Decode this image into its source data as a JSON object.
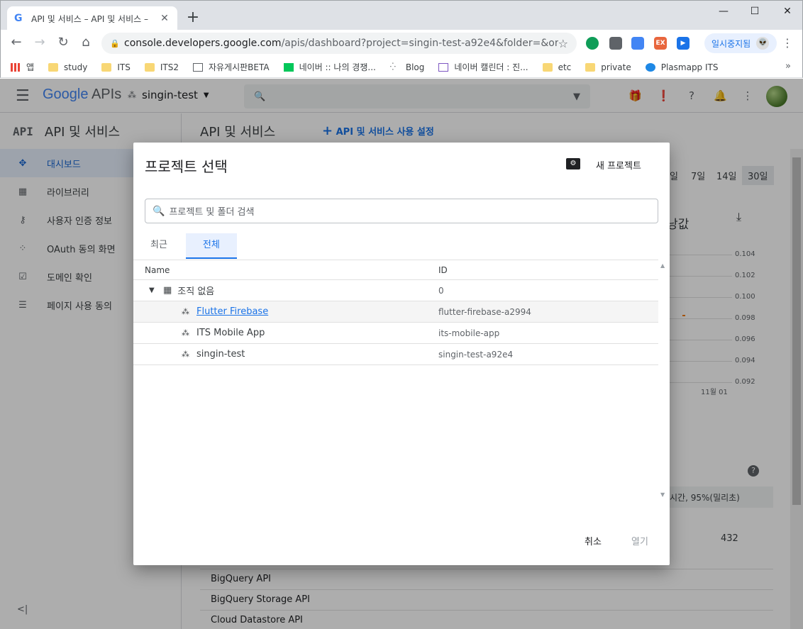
{
  "browser": {
    "tab_title": "API 및 서비스 – API 및 서비스 –",
    "url_host": "console.developers.google.com",
    "url_rest": "/apis/dashboard?project=singin-test-a92e4&folder=&organi...",
    "profile_label": "일시중지됨",
    "ext_labels": [
      "EX"
    ],
    "bookmarks": [
      {
        "label": "앱",
        "icon": "apps-grid-icon"
      },
      {
        "label": "study",
        "icon": "folder-icon"
      },
      {
        "label": "ITS",
        "icon": "folder-icon"
      },
      {
        "label": "ITS2",
        "icon": "folder-icon"
      },
      {
        "label": "자유게시판BETA",
        "icon": "board-icon"
      },
      {
        "label": "네이버 :: 나의 경쟁...",
        "icon": "naver-icon"
      },
      {
        "label": "Blog",
        "icon": "blog-icon"
      },
      {
        "label": "네이버 캘린더 : 진...",
        "icon": "calendar-icon"
      },
      {
        "label": "etc",
        "icon": "folder-icon"
      },
      {
        "label": "private",
        "icon": "folder-icon"
      },
      {
        "label": "Plasmapp ITS",
        "icon": "plasmapp-icon"
      }
    ]
  },
  "gcp": {
    "logo_google": "Google",
    "logo_apis": "APIs",
    "project": "singin-test",
    "sidebar_title": "API 및 서비스",
    "sidebar_items": [
      {
        "label": "대시보드",
        "icon": "dashboard-icon"
      },
      {
        "label": "라이브러리",
        "icon": "library-icon"
      },
      {
        "label": "사용자 인증 정보",
        "icon": "key-icon"
      },
      {
        "label": "OAuth 동의 화면",
        "icon": "oauth-icon"
      },
      {
        "label": "도메인 확인",
        "icon": "domain-check-icon"
      },
      {
        "label": "페이지 사용 동의",
        "icon": "settings-page-icon"
      }
    ],
    "main_title": "API 및 서비스",
    "enable_link": "API 및 서비스 사용 설정",
    "ranges": [
      "일",
      "7일",
      "14일",
      "30일"
    ],
    "chart_title_partial": "낭값",
    "yticks": [
      "0.104",
      "0.102",
      "0.100",
      "0.098",
      "0.096",
      "0.094",
      "0.092"
    ],
    "xtick": "11월 01",
    "col_head_partial": "시간, 95%(밀리초)",
    "row_value": "432",
    "api_rows": [
      "BigQuery API",
      "BigQuery Storage API",
      "Cloud Datastore API"
    ]
  },
  "dialog": {
    "title": "프로젝트 선택",
    "new_project": "새 프로젝트",
    "search_placeholder": "프로젝트 및 폴더 검색",
    "tabs": [
      "최근",
      "전체"
    ],
    "col_name": "Name",
    "col_id": "ID",
    "org": {
      "name": "조직 없음",
      "id": "0"
    },
    "projects": [
      {
        "name": "Flutter Firebase",
        "id": "flutter-firebase-a2994"
      },
      {
        "name": "ITS Mobile App",
        "id": "its-mobile-app"
      },
      {
        "name": "singin-test",
        "id": "singin-test-a92e4"
      }
    ],
    "cancel": "취소",
    "open": "열기"
  }
}
